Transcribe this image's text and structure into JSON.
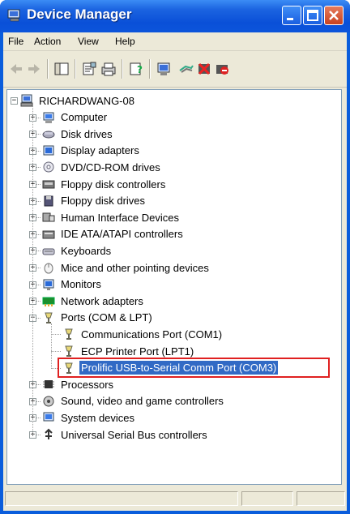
{
  "window": {
    "title": "Device Manager"
  },
  "menu": [
    "File",
    "Action",
    "View",
    "Help"
  ],
  "toolbar": {
    "buttons": [
      "back-icon",
      "forward-icon",
      "show-hide-console-tree-icon",
      "properties-icon",
      "print-icon",
      "help-icon",
      "scan-hardware-icon",
      "update-driver-icon",
      "uninstall-icon",
      "disable-icon"
    ]
  },
  "tree": {
    "root": "RICHARDWANG-08",
    "categories": [
      {
        "label": "Computer",
        "icon": "computer-icon"
      },
      {
        "label": "Disk drives",
        "icon": "disk-drive-icon"
      },
      {
        "label": "Display adapters",
        "icon": "display-adapter-icon"
      },
      {
        "label": "DVD/CD-ROM drives",
        "icon": "dvd-drive-icon"
      },
      {
        "label": "Floppy disk controllers",
        "icon": "floppy-controller-icon"
      },
      {
        "label": "Floppy disk drives",
        "icon": "floppy-drive-icon"
      },
      {
        "label": "Human Interface Devices",
        "icon": "hid-icon"
      },
      {
        "label": "IDE ATA/ATAPI controllers",
        "icon": "ide-controller-icon"
      },
      {
        "label": "Keyboards",
        "icon": "keyboard-icon"
      },
      {
        "label": "Mice and other pointing devices",
        "icon": "mouse-icon"
      },
      {
        "label": "Monitors",
        "icon": "monitor-icon"
      },
      {
        "label": "Network adapters",
        "icon": "network-adapter-icon"
      },
      {
        "label": "Ports (COM & LPT)",
        "icon": "port-icon"
      },
      {
        "label": "Processors",
        "icon": "processor-icon"
      },
      {
        "label": "Sound, video and game controllers",
        "icon": "sound-icon"
      },
      {
        "label": "System devices",
        "icon": "system-device-icon"
      },
      {
        "label": "Universal Serial Bus controllers",
        "icon": "usb-icon"
      }
    ],
    "ports": [
      {
        "label": "Communications Port (COM1)"
      },
      {
        "label": "ECP Printer Port (LPT1)"
      },
      {
        "label": "Prolific USB-to-Serial Comm Port (COM3)",
        "selected": true
      }
    ]
  },
  "colors": {
    "title_blue": "#0a5ddc",
    "selection": "#316ac5",
    "highlight_box": "#e02020"
  }
}
